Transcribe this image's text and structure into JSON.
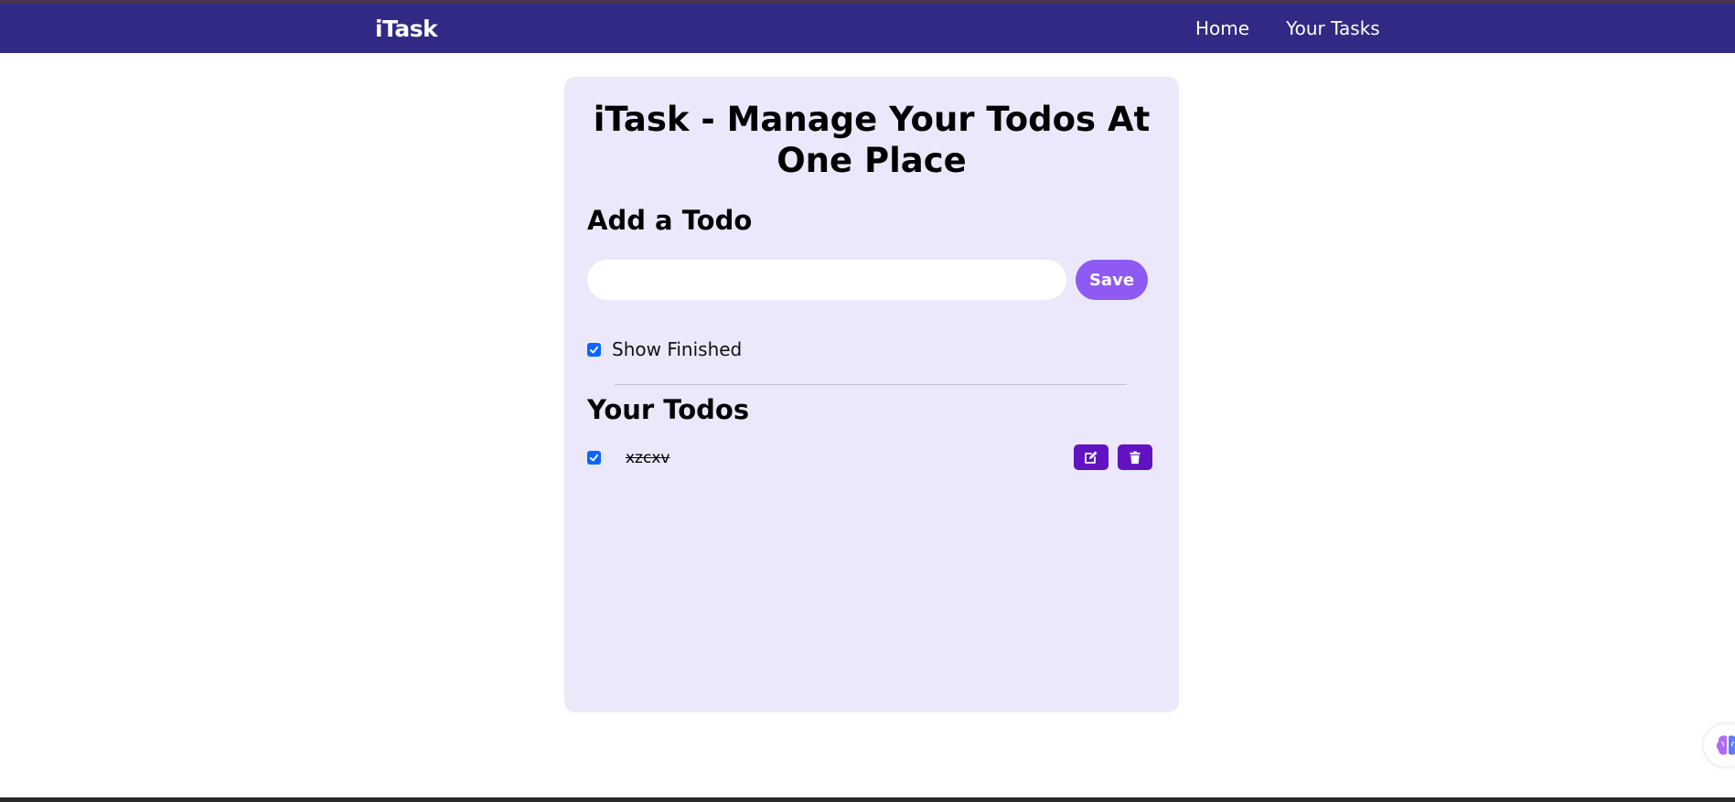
{
  "navbar": {
    "brand": "iTask",
    "links": [
      "Home",
      "Your Tasks"
    ]
  },
  "main": {
    "title": "iTask - Manage Your Todos At One Place",
    "add_heading": "Add a Todo",
    "input_value": "",
    "save_label": "Save",
    "show_finished_label": "Show Finished",
    "show_finished_checked": true,
    "todos_heading": "Your Todos",
    "todos": [
      {
        "text": "xzcxv",
        "done": true
      }
    ]
  },
  "colors": {
    "navbar_bg": "#312a84",
    "card_bg": "#ebe8fc",
    "save_button": "#8f59f3",
    "action_button": "#6113c2",
    "checkbox": "#0b66ff"
  },
  "icons": [
    "edit-icon",
    "trash-icon",
    "brain-icon",
    "check-icon"
  ]
}
